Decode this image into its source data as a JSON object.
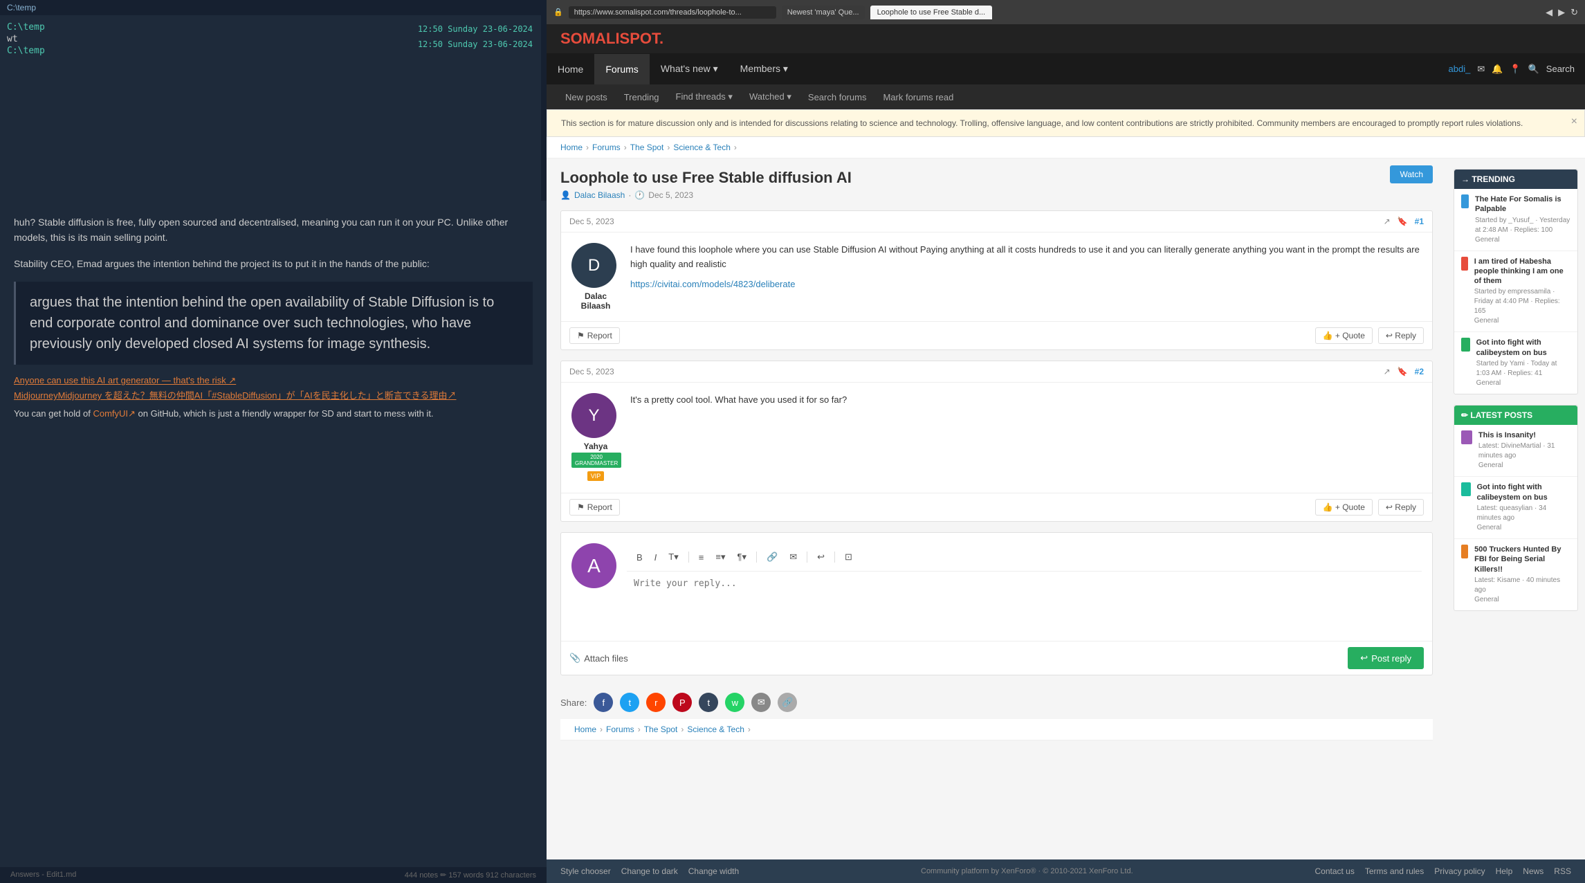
{
  "browser": {
    "url": "https://www.somalispot.com/threads/loophole-to...",
    "tab_label": "Loophole to use Free Stable d...",
    "tab_left": "Newest 'maya' Que..."
  },
  "site": {
    "name": "SOMALISPOT",
    "dot_color": "#e74c3c"
  },
  "nav": {
    "items": [
      {
        "label": "Home",
        "active": false
      },
      {
        "label": "Forums",
        "active": true
      },
      {
        "label": "What's new",
        "active": false,
        "dropdown": true
      },
      {
        "label": "Members",
        "active": false,
        "dropdown": true
      }
    ],
    "right": {
      "username": "abdi_",
      "search_label": "Search"
    }
  },
  "subnav": {
    "items": [
      {
        "label": "New posts"
      },
      {
        "label": "Trending"
      },
      {
        "label": "Find threads"
      },
      {
        "label": "Watched"
      },
      {
        "label": "Search forums"
      },
      {
        "label": "Mark forums read"
      }
    ]
  },
  "notice": {
    "text": "This section is for mature discussion only and is intended for discussions relating to science and technology. Trolling, offensive language, and low content contributions are strictly prohibited. Community members are encouraged to promptly report rules violations."
  },
  "breadcrumb": {
    "items": [
      "Home",
      "Forums",
      "The Spot",
      "Science & Tech"
    ]
  },
  "thread": {
    "title": "Loophole to use Free Stable diffusion AI",
    "author": "Dalac Bilaash",
    "date": "Dec 5, 2023",
    "watch_label": "Watch"
  },
  "posts": [
    {
      "id": "1",
      "number": "#1",
      "date": "Dec 5, 2023",
      "username": "Dalac Bilaash",
      "avatar_initial": "D",
      "avatar_color": "#2c3e50",
      "text": "I have found this loophole where you can use Stable Diffusion AI without Paying anything at all it costs hundreds to use it and you can literally generate anything you want in the prompt the results are high quality and realistic",
      "link": "https://civitai.com/models/4823/deliberate",
      "actions": [
        "Report",
        "Quote",
        "+ Quote",
        "Reply"
      ]
    },
    {
      "id": "2",
      "number": "#2",
      "date": "Dec 5, 2023",
      "username": "Yahya",
      "avatar_initial": "Y",
      "avatar_color": "#6c3483",
      "badge": "2020 GRANDMASTER",
      "badge_color": "#27ae60",
      "vip": true,
      "text": "It's a pretty cool tool. What have you used it for so far?",
      "actions": [
        "Report",
        "Quote",
        "+ Quote",
        "Reply"
      ]
    }
  ],
  "reply_box": {
    "avatar_initial": "A",
    "avatar_color": "#8e44ad",
    "placeholder": "Write your reply...",
    "attach_label": "Attach files",
    "post_label": "Post reply",
    "toolbar": [
      "B",
      "I",
      "T↓",
      "|",
      "≡",
      "≡↓",
      "¶↓",
      "|",
      "🔗",
      "✉",
      "|",
      "↩",
      "|",
      "⊡"
    ]
  },
  "share": {
    "label": "Share:",
    "icons": [
      "f",
      "t",
      "r",
      "P",
      "t",
      "w",
      "✉",
      "🔗"
    ]
  },
  "sidebar": {
    "trending": {
      "header": "→ TRENDING",
      "items": [
        {
          "title": "The Hate For Somalis is Palpable",
          "meta": "Started by _Yusuf_ · Yesterday at 2:48 AM · Replies: 100",
          "category": "General"
        },
        {
          "title": "I am tired of Habesha people thinking I am one of them",
          "meta": "Started by empressamila · Friday at 4:40 PM · Replies: 165",
          "category": "General"
        },
        {
          "title": "Got into fight with calibeystem on bus",
          "meta": "Started by Yami · Today at 1:03 AM · Replies: 41",
          "category": "General"
        }
      ]
    },
    "latest": {
      "header": "✏ LATEST POSTS",
      "items": [
        {
          "title": "This is Insanity!",
          "meta": "Latest: DivineMartial · 31 minutes ago",
          "category": "General"
        },
        {
          "title": "Got into fight with calibeystem on bus",
          "meta": "Latest: queasylian · 34 minutes ago",
          "category": "General"
        },
        {
          "title": "500 Truckers Hunted By FBI for Being Serial Killers!!",
          "meta": "Latest: Kisame · 40 minutes ago",
          "category": "General"
        }
      ]
    }
  },
  "footer": {
    "links": [
      "Style chooser",
      "Change to dark",
      "Change width"
    ],
    "right_links": [
      "Contact us",
      "Terms and rules",
      "Privacy policy",
      "Help",
      "News",
      "RSS"
    ],
    "copyright": "Community platform by XenForo® · © 2010-2021 XenForo Ltd."
  },
  "terminal": {
    "path1": "C:\\temp",
    "cmd": "wt",
    "path2": "C:\\temp",
    "time1": "12:50 Sunday 23-06-2024",
    "time2": "12:50 Sunday 23-06-2024"
  },
  "editor": {
    "text1": "huh? Stable diffusion is free, fully open sourced and decentralised, meaning you can run it on your PC. Unlike other models, this is its main selling point.",
    "subtitle": "Stability CEO, Emad argues the intention behind the project its to put it in the hands of the public:",
    "quote": "argues that the intention behind the open availability of Stable Diffusion is to end corporate control and dominance over such technologies, who have previously only developed closed AI systems for image synthesis.",
    "link1": "Anyone can use this AI art generator — that's the risk ↗",
    "link2": "MidjourneyMidjourney を超えた？無料の仲間AI「#StableDiffusion」が「AIを民主化した」と断言できる理由↗",
    "text2": "You can get hold of",
    "inline_link": "ComfyUI↗",
    "text3": " on GitHub, which is just a friendly wrapper for SD and start to mess with it.",
    "footer_left": "Answers - Edit1.md",
    "footer_right": "444 notes   ✏ 157 words  912 characters"
  }
}
